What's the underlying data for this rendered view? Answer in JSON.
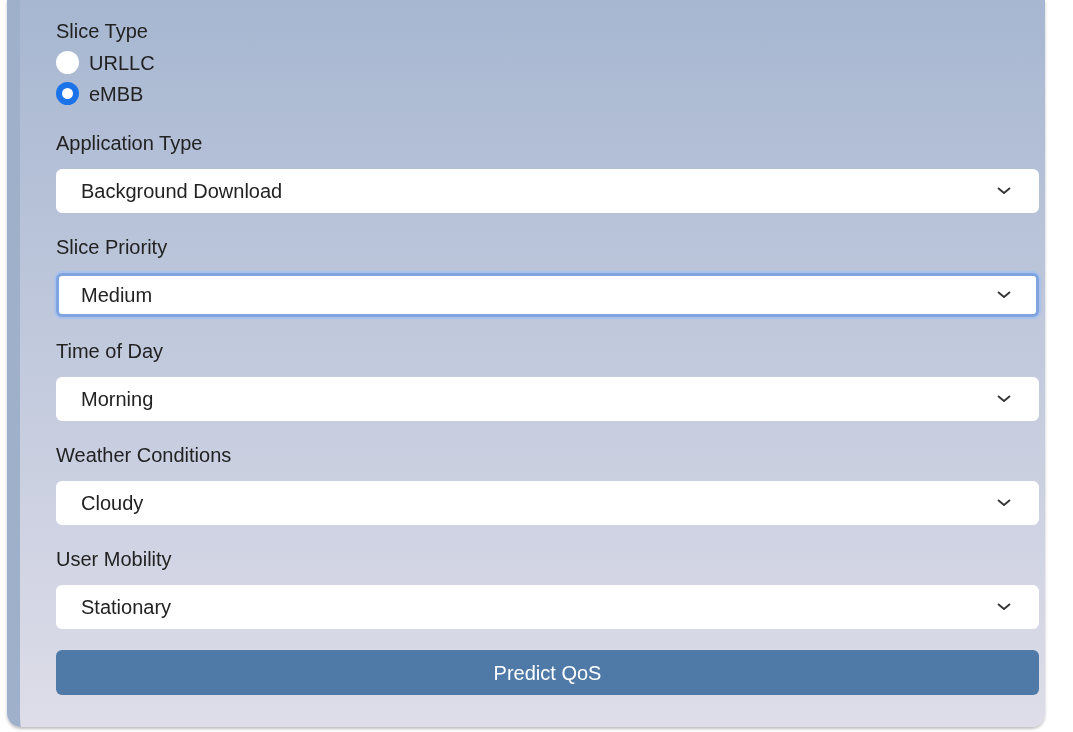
{
  "slice_type": {
    "label": "Slice Type",
    "options": [
      {
        "label": "URLLC",
        "selected": false
      },
      {
        "label": "eMBB",
        "selected": true
      }
    ]
  },
  "fields": [
    {
      "label": "Application Type",
      "value": "Background Download",
      "focused": false
    },
    {
      "label": "Slice Priority",
      "value": "Medium",
      "focused": true
    },
    {
      "label": "Time of Day",
      "value": "Morning",
      "focused": false
    },
    {
      "label": "Weather Conditions",
      "value": "Cloudy",
      "focused": false
    },
    {
      "label": "User Mobility",
      "value": "Stationary",
      "focused": false
    }
  ],
  "button": "Predict QoS"
}
